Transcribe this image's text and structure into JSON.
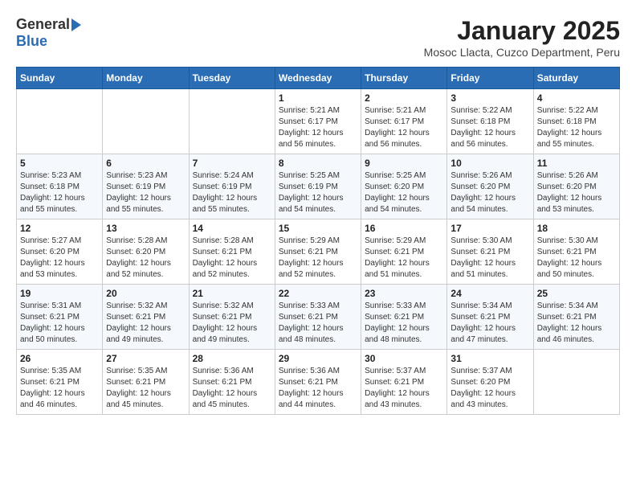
{
  "logo": {
    "general": "General",
    "blue": "Blue"
  },
  "title": "January 2025",
  "subtitle": "Mosoc Llacta, Cuzco Department, Peru",
  "weekdays": [
    "Sunday",
    "Monday",
    "Tuesday",
    "Wednesday",
    "Thursday",
    "Friday",
    "Saturday"
  ],
  "weeks": [
    [
      {
        "day": "",
        "info": ""
      },
      {
        "day": "",
        "info": ""
      },
      {
        "day": "",
        "info": ""
      },
      {
        "day": "1",
        "info": "Sunrise: 5:21 AM\nSunset: 6:17 PM\nDaylight: 12 hours\nand 56 minutes."
      },
      {
        "day": "2",
        "info": "Sunrise: 5:21 AM\nSunset: 6:17 PM\nDaylight: 12 hours\nand 56 minutes."
      },
      {
        "day": "3",
        "info": "Sunrise: 5:22 AM\nSunset: 6:18 PM\nDaylight: 12 hours\nand 56 minutes."
      },
      {
        "day": "4",
        "info": "Sunrise: 5:22 AM\nSunset: 6:18 PM\nDaylight: 12 hours\nand 55 minutes."
      }
    ],
    [
      {
        "day": "5",
        "info": "Sunrise: 5:23 AM\nSunset: 6:18 PM\nDaylight: 12 hours\nand 55 minutes."
      },
      {
        "day": "6",
        "info": "Sunrise: 5:23 AM\nSunset: 6:19 PM\nDaylight: 12 hours\nand 55 minutes."
      },
      {
        "day": "7",
        "info": "Sunrise: 5:24 AM\nSunset: 6:19 PM\nDaylight: 12 hours\nand 55 minutes."
      },
      {
        "day": "8",
        "info": "Sunrise: 5:25 AM\nSunset: 6:19 PM\nDaylight: 12 hours\nand 54 minutes."
      },
      {
        "day": "9",
        "info": "Sunrise: 5:25 AM\nSunset: 6:20 PM\nDaylight: 12 hours\nand 54 minutes."
      },
      {
        "day": "10",
        "info": "Sunrise: 5:26 AM\nSunset: 6:20 PM\nDaylight: 12 hours\nand 54 minutes."
      },
      {
        "day": "11",
        "info": "Sunrise: 5:26 AM\nSunset: 6:20 PM\nDaylight: 12 hours\nand 53 minutes."
      }
    ],
    [
      {
        "day": "12",
        "info": "Sunrise: 5:27 AM\nSunset: 6:20 PM\nDaylight: 12 hours\nand 53 minutes."
      },
      {
        "day": "13",
        "info": "Sunrise: 5:28 AM\nSunset: 6:20 PM\nDaylight: 12 hours\nand 52 minutes."
      },
      {
        "day": "14",
        "info": "Sunrise: 5:28 AM\nSunset: 6:21 PM\nDaylight: 12 hours\nand 52 minutes."
      },
      {
        "day": "15",
        "info": "Sunrise: 5:29 AM\nSunset: 6:21 PM\nDaylight: 12 hours\nand 52 minutes."
      },
      {
        "day": "16",
        "info": "Sunrise: 5:29 AM\nSunset: 6:21 PM\nDaylight: 12 hours\nand 51 minutes."
      },
      {
        "day": "17",
        "info": "Sunrise: 5:30 AM\nSunset: 6:21 PM\nDaylight: 12 hours\nand 51 minutes."
      },
      {
        "day": "18",
        "info": "Sunrise: 5:30 AM\nSunset: 6:21 PM\nDaylight: 12 hours\nand 50 minutes."
      }
    ],
    [
      {
        "day": "19",
        "info": "Sunrise: 5:31 AM\nSunset: 6:21 PM\nDaylight: 12 hours\nand 50 minutes."
      },
      {
        "day": "20",
        "info": "Sunrise: 5:32 AM\nSunset: 6:21 PM\nDaylight: 12 hours\nand 49 minutes."
      },
      {
        "day": "21",
        "info": "Sunrise: 5:32 AM\nSunset: 6:21 PM\nDaylight: 12 hours\nand 49 minutes."
      },
      {
        "day": "22",
        "info": "Sunrise: 5:33 AM\nSunset: 6:21 PM\nDaylight: 12 hours\nand 48 minutes."
      },
      {
        "day": "23",
        "info": "Sunrise: 5:33 AM\nSunset: 6:21 PM\nDaylight: 12 hours\nand 48 minutes."
      },
      {
        "day": "24",
        "info": "Sunrise: 5:34 AM\nSunset: 6:21 PM\nDaylight: 12 hours\nand 47 minutes."
      },
      {
        "day": "25",
        "info": "Sunrise: 5:34 AM\nSunset: 6:21 PM\nDaylight: 12 hours\nand 46 minutes."
      }
    ],
    [
      {
        "day": "26",
        "info": "Sunrise: 5:35 AM\nSunset: 6:21 PM\nDaylight: 12 hours\nand 46 minutes."
      },
      {
        "day": "27",
        "info": "Sunrise: 5:35 AM\nSunset: 6:21 PM\nDaylight: 12 hours\nand 45 minutes."
      },
      {
        "day": "28",
        "info": "Sunrise: 5:36 AM\nSunset: 6:21 PM\nDaylight: 12 hours\nand 45 minutes."
      },
      {
        "day": "29",
        "info": "Sunrise: 5:36 AM\nSunset: 6:21 PM\nDaylight: 12 hours\nand 44 minutes."
      },
      {
        "day": "30",
        "info": "Sunrise: 5:37 AM\nSunset: 6:21 PM\nDaylight: 12 hours\nand 43 minutes."
      },
      {
        "day": "31",
        "info": "Sunrise: 5:37 AM\nSunset: 6:20 PM\nDaylight: 12 hours\nand 43 minutes."
      },
      {
        "day": "",
        "info": ""
      }
    ]
  ]
}
